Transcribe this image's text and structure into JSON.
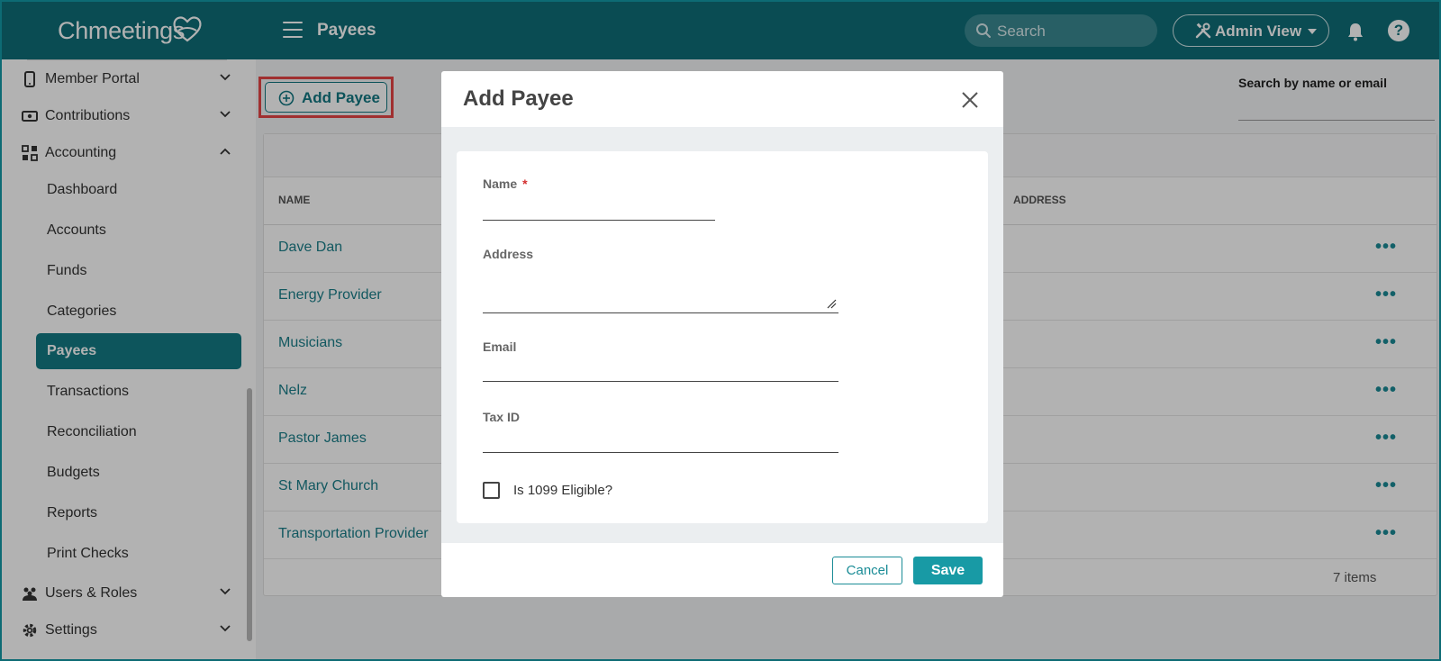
{
  "app": {
    "logo_text": "Chmeetings"
  },
  "header": {
    "page_title": "Payees",
    "search_placeholder": "Search",
    "view_label": "Admin View",
    "help_label": "?"
  },
  "sidebar": {
    "sections": [
      {
        "label": "Member Portal",
        "icon": "phone-icon",
        "expanded": false
      },
      {
        "label": "Contributions",
        "icon": "money-icon",
        "expanded": false
      },
      {
        "label": "Accounting",
        "icon": "accounting-icon",
        "expanded": true
      }
    ],
    "accounting_items": [
      {
        "label": "Dashboard",
        "active": false
      },
      {
        "label": "Accounts",
        "active": false
      },
      {
        "label": "Funds",
        "active": false
      },
      {
        "label": "Categories",
        "active": false
      },
      {
        "label": "Payees",
        "active": true
      },
      {
        "label": "Transactions",
        "active": false
      },
      {
        "label": "Reconciliation",
        "active": false
      },
      {
        "label": "Budgets",
        "active": false
      },
      {
        "label": "Reports",
        "active": false
      },
      {
        "label": "Print Checks",
        "active": false
      }
    ],
    "bottom_sections": [
      {
        "label": "Users & Roles",
        "icon": "users-icon"
      },
      {
        "label": "Settings",
        "icon": "gear-icon"
      }
    ]
  },
  "main": {
    "add_button_label": "Add Payee",
    "search_label": "Search by name or email",
    "columns": [
      "NAME",
      "ADDRESS"
    ],
    "rows": [
      {
        "name": "Dave Dan"
      },
      {
        "name": "Energy Provider"
      },
      {
        "name": "Musicians"
      },
      {
        "name": "Nelz"
      },
      {
        "name": "Pastor James"
      },
      {
        "name": "St Mary Church"
      },
      {
        "name": "Transportation Provider"
      }
    ],
    "row_menu_label": "•••",
    "items_count": "7 items"
  },
  "modal": {
    "title": "Add Payee",
    "fields": {
      "name_label": "Name",
      "required_mark": "*",
      "address_label": "Address",
      "email_label": "Email",
      "taxid_label": "Tax ID",
      "eligible_label": "Is 1099 Eligible?"
    },
    "values": {
      "name": "",
      "address": "",
      "email": "",
      "tax_id": "",
      "eligible": false
    },
    "cancel_label": "Cancel",
    "save_label": "Save"
  },
  "colors": {
    "brand_teal": "#0f6e78",
    "active_nav": "#137a84",
    "highlight_red": "#e64646",
    "save_button": "#189aa5"
  }
}
